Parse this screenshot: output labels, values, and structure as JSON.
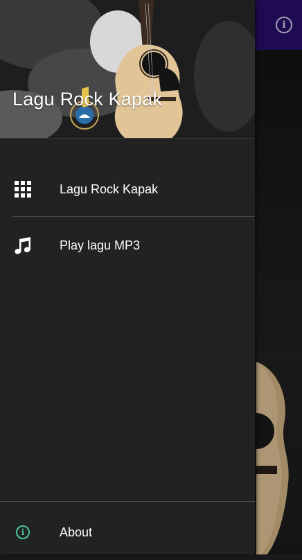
{
  "app": {
    "info_icon": "info-icon"
  },
  "drawer": {
    "header": {
      "title": "Lagu Rock Kapak"
    },
    "items": [
      {
        "label": "Lagu Rock Kapak",
        "icon": "grid-icon"
      },
      {
        "label": "Play lagu MP3",
        "icon": "music-note-icon"
      }
    ],
    "footer": {
      "label": "About",
      "icon": "info-icon"
    }
  },
  "colors": {
    "toolbar": "#2a0f6e",
    "drawer_bg": "#212322",
    "accent": "#4fc3a1"
  }
}
